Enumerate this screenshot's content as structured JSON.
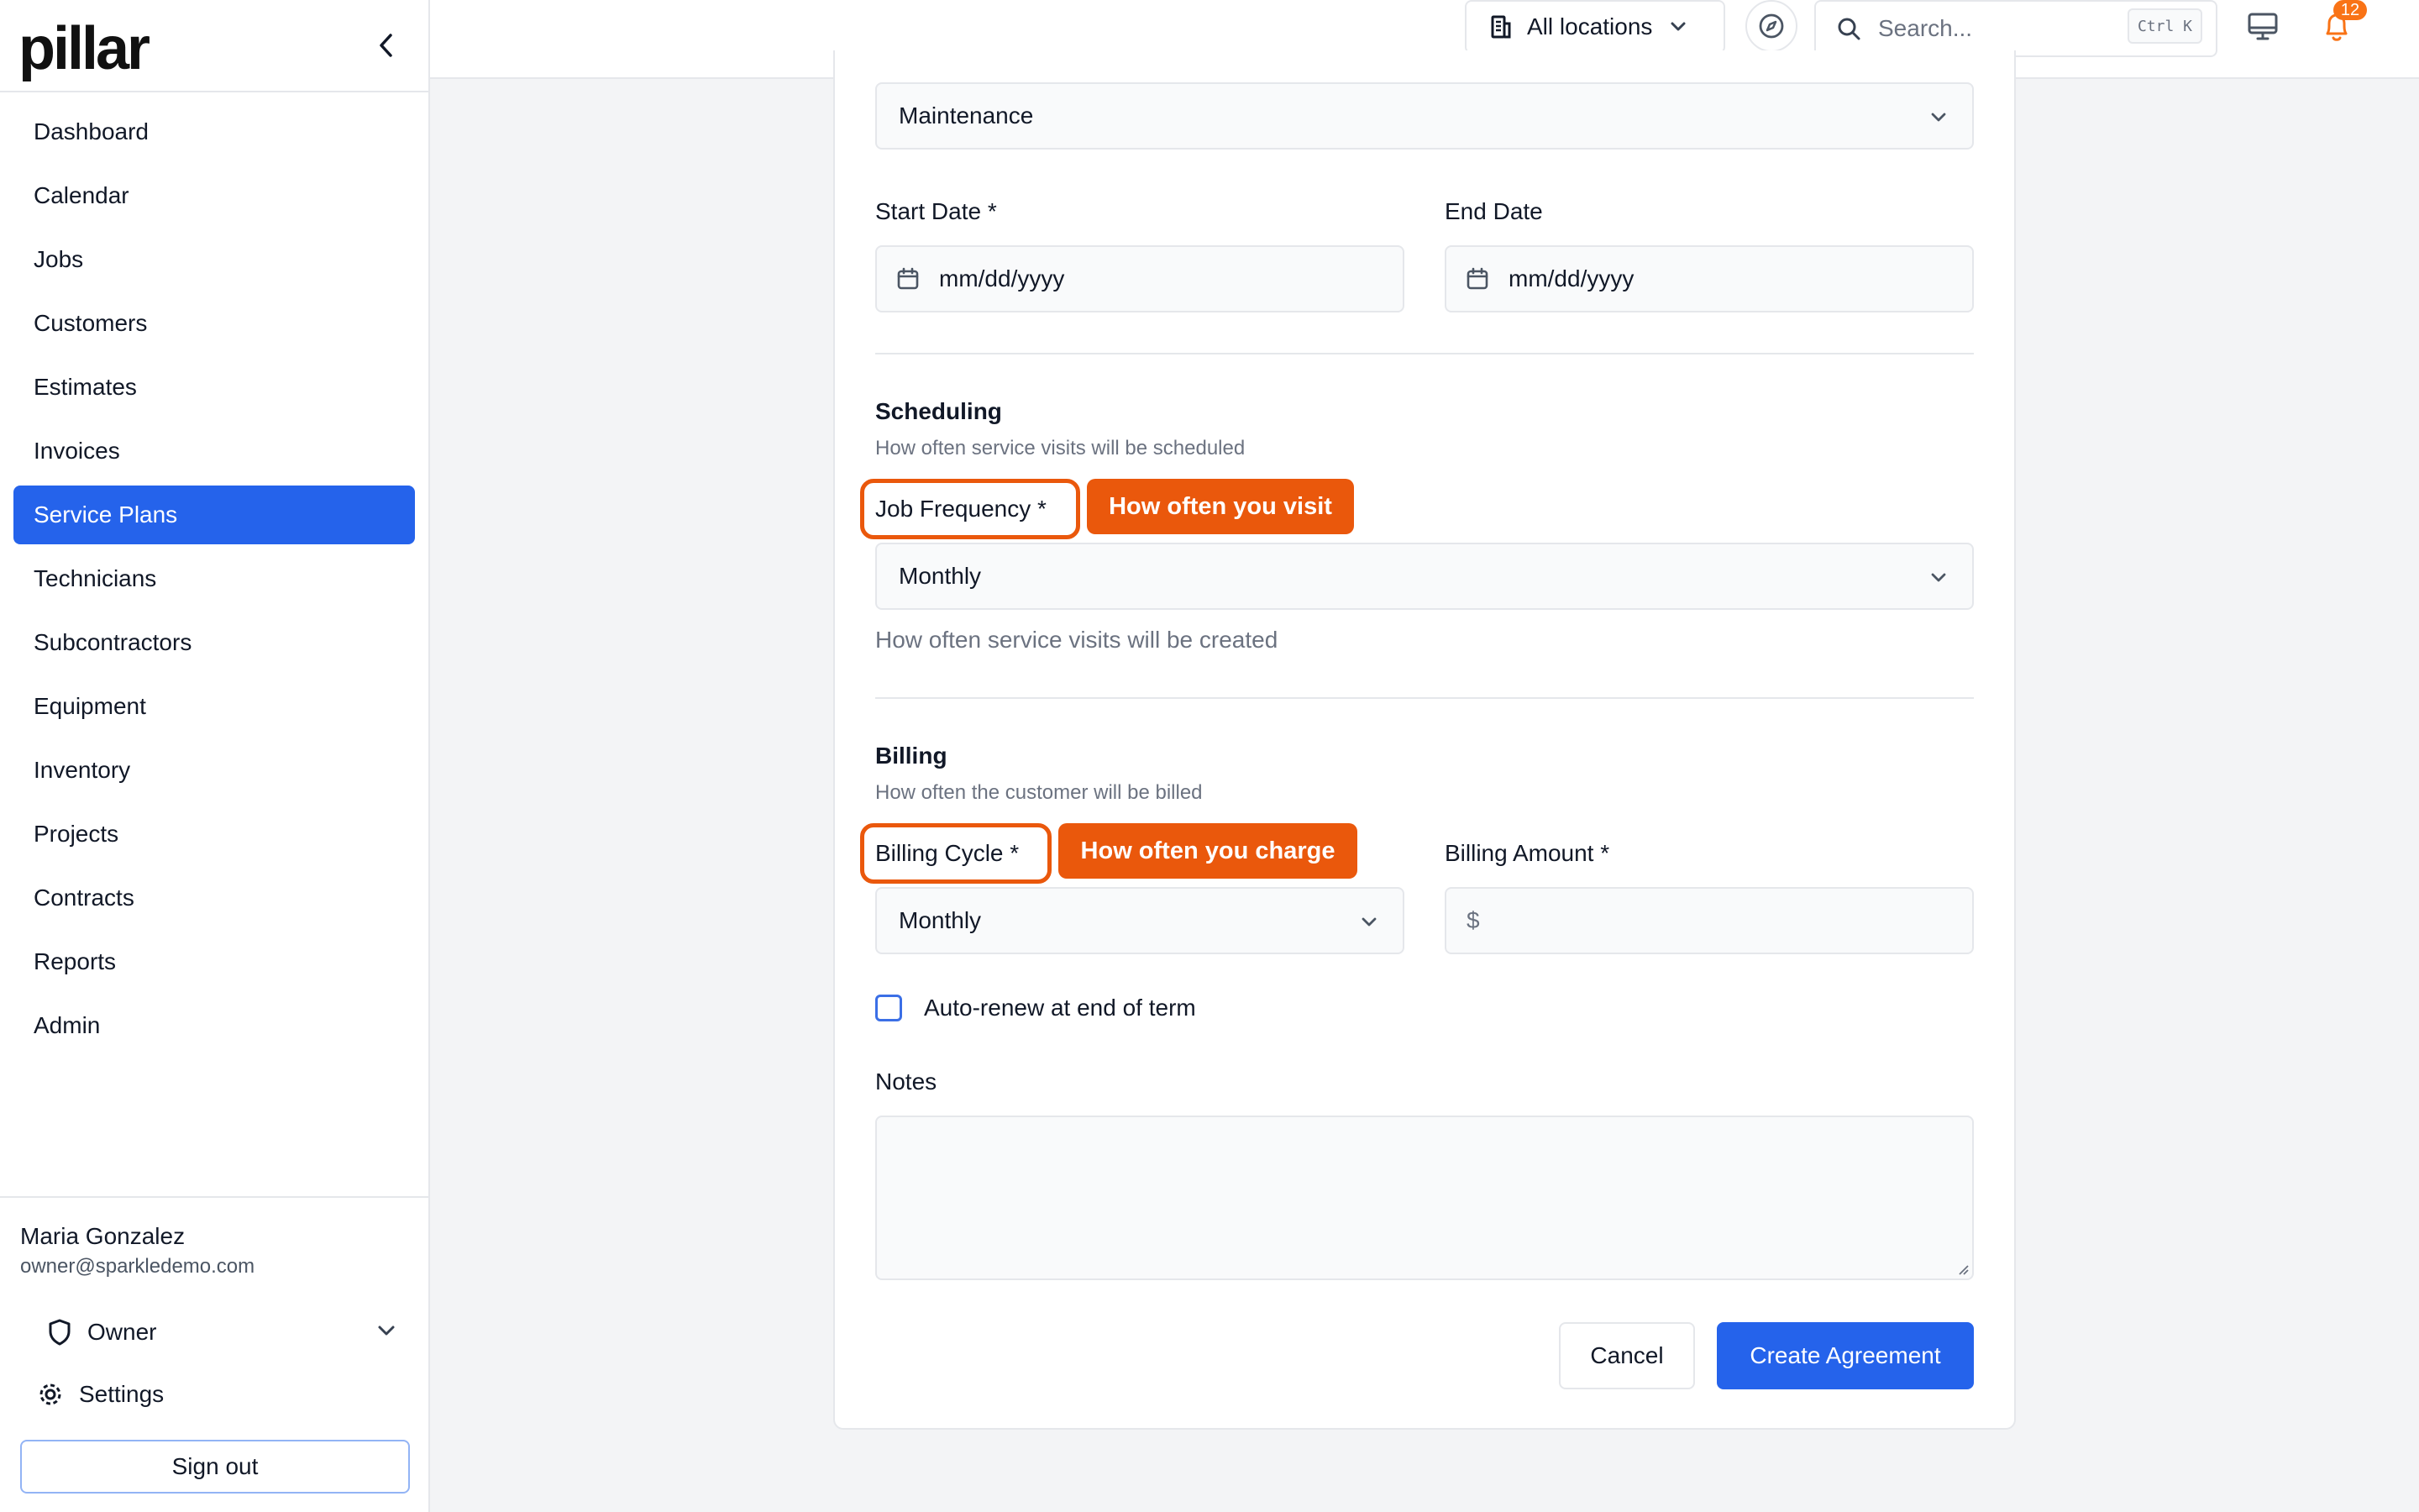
{
  "sidebar": {
    "logo": "pillar",
    "nav": [
      {
        "label": "Dashboard"
      },
      {
        "label": "Calendar"
      },
      {
        "label": "Jobs"
      },
      {
        "label": "Customers"
      },
      {
        "label": "Estimates"
      },
      {
        "label": "Invoices"
      },
      {
        "label": "Service Plans",
        "active": true
      },
      {
        "label": "Technicians"
      },
      {
        "label": "Subcontractors"
      },
      {
        "label": "Equipment"
      },
      {
        "label": "Inventory"
      },
      {
        "label": "Projects"
      },
      {
        "label": "Contracts"
      },
      {
        "label": "Reports"
      },
      {
        "label": "Admin"
      }
    ],
    "user": {
      "name": "Maria Gonzalez",
      "email": "owner@sparkledemo.com",
      "role": "Owner"
    },
    "settings_label": "Settings",
    "signout_label": "Sign out"
  },
  "topbar": {
    "location_label": "All locations",
    "search_placeholder": "Search...",
    "search_shortcut": "Ctrl K",
    "notification_count": "12"
  },
  "form": {
    "type_value": "Maintenance",
    "start_date_label": "Start Date *",
    "start_date_placeholder": "mm/dd/yyyy",
    "end_date_label": "End Date",
    "end_date_placeholder": "mm/dd/yyyy",
    "scheduling": {
      "title": "Scheduling",
      "subtitle": "How often service visits will be scheduled",
      "job_frequency_label": "Job Frequency *",
      "job_frequency_callout": "How often you visit",
      "job_frequency_value": "Monthly",
      "job_frequency_helper": "How often service visits will be created"
    },
    "billing": {
      "title": "Billing",
      "subtitle": "How often the customer will be billed",
      "billing_cycle_label": "Billing Cycle *",
      "billing_cycle_callout": "How often you charge",
      "billing_cycle_value": "Monthly",
      "billing_amount_label": "Billing Amount *",
      "currency_symbol": "$"
    },
    "auto_renew_label": "Auto-renew at end of term",
    "notes_label": "Notes",
    "cancel_label": "Cancel",
    "submit_label": "Create Agreement"
  },
  "colors": {
    "primary": "#2563eb",
    "callout": "#ea580c",
    "badge": "#f97316"
  }
}
